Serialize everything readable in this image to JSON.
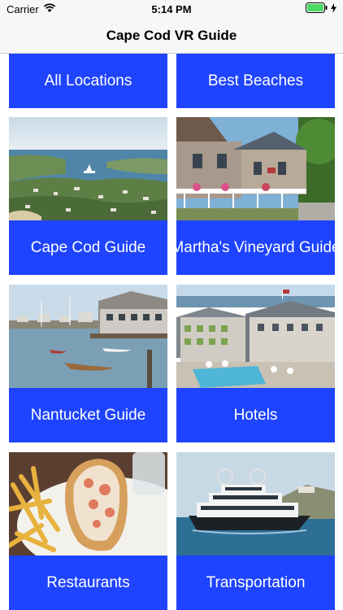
{
  "status_bar": {
    "carrier": "Carrier",
    "time": "5:14 PM"
  },
  "nav": {
    "title": "Cape Cod VR Guide"
  },
  "tiles": [
    {
      "label": "All Locations"
    },
    {
      "label": "Best Beaches"
    },
    {
      "label": "Cape Cod Guide",
      "image": "harbor-aerial-photo"
    },
    {
      "label": "Martha's Vineyard Guide",
      "image": "victorian-cottage-photo"
    },
    {
      "label": "Nantucket Guide",
      "image": "harbor-docks-photo"
    },
    {
      "label": "Hotels",
      "image": "hotel-pool-photo"
    },
    {
      "label": "Restaurants",
      "image": "lobster-roll-photo"
    },
    {
      "label": "Transportation",
      "image": "ferry-boat-photo"
    }
  ],
  "colors": {
    "tile_blue": "#1f44ff",
    "nav_bg": "#f7f7f7",
    "battery": "#4cd964"
  }
}
